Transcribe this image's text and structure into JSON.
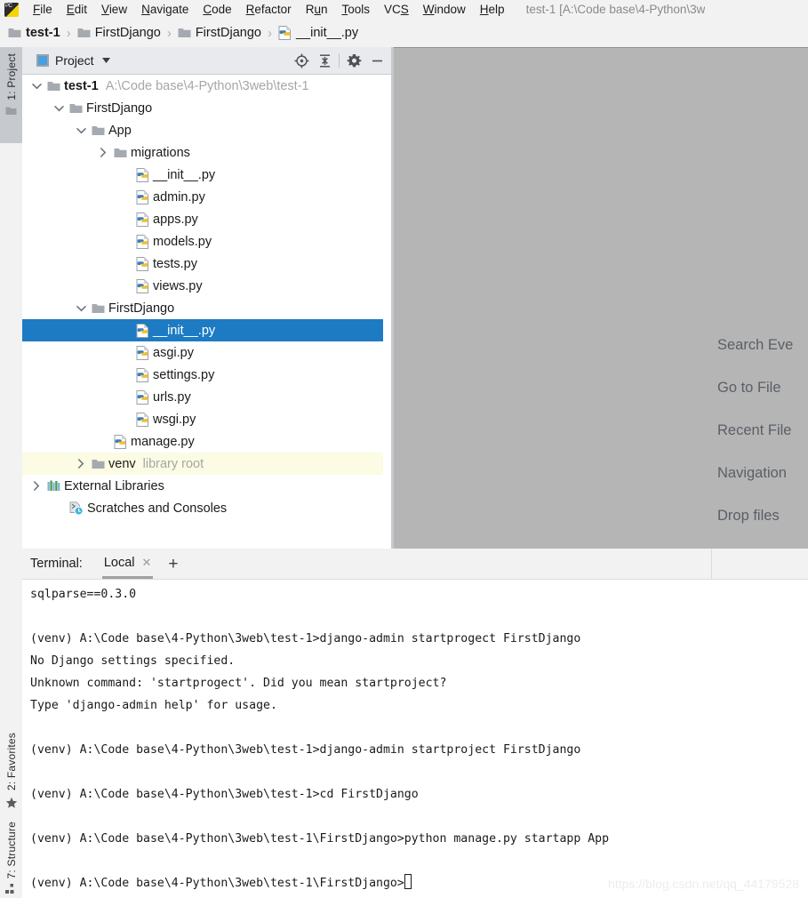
{
  "app": {
    "logo_icon": "pycharm-logo-icon",
    "window_title": "test-1 [A:\\Code base\\4-Python\\3w"
  },
  "menubar": {
    "items": [
      {
        "label": "File",
        "mnemonic": "F"
      },
      {
        "label": "Edit",
        "mnemonic": "E"
      },
      {
        "label": "View",
        "mnemonic": "V"
      },
      {
        "label": "Navigate",
        "mnemonic": "N"
      },
      {
        "label": "Code",
        "mnemonic": "C"
      },
      {
        "label": "Refactor",
        "mnemonic": "R"
      },
      {
        "label": "Run",
        "mnemonic": "u"
      },
      {
        "label": "Tools",
        "mnemonic": "T"
      },
      {
        "label": "VCS",
        "mnemonic": "S"
      },
      {
        "label": "Window",
        "mnemonic": "W"
      },
      {
        "label": "Help",
        "mnemonic": "H"
      }
    ]
  },
  "breadcrumb": {
    "separator": "›",
    "items": [
      {
        "label": "test-1",
        "icon": "folder-icon",
        "bold": true
      },
      {
        "label": "FirstDjango",
        "icon": "folder-icon",
        "bold": false
      },
      {
        "label": "FirstDjango",
        "icon": "folder-icon",
        "bold": false
      },
      {
        "label": "__init__.py",
        "icon": "python-file-icon",
        "bold": false
      }
    ]
  },
  "left_strip": {
    "top_tabs": [
      {
        "label": "1: Project",
        "icon": "folder-icon"
      }
    ],
    "bottom_tabs": [
      {
        "label": "2: Favorites",
        "icon": "star-icon"
      },
      {
        "label": "7: Structure",
        "icon": "structure-icon"
      }
    ]
  },
  "project_panel": {
    "title": "Project",
    "tile_icon": "project-tile-icon",
    "caret_icon": "chevron-down-icon",
    "tools": [
      {
        "name": "locate-icon",
        "tooltip": "Select Opened File"
      },
      {
        "name": "collapse-all-icon",
        "tooltip": "Collapse All"
      },
      {
        "name": "gear-icon",
        "tooltip": "Settings"
      },
      {
        "name": "minimize-icon",
        "tooltip": "Hide"
      }
    ],
    "tree": [
      {
        "label": "test-1",
        "note": "A:\\Code base\\4-Python\\3web\\test-1",
        "indent": 0,
        "arrow": "expanded",
        "icon": "folder-icon",
        "bold": true,
        "state": "normal"
      },
      {
        "label": "FirstDjango",
        "note": "",
        "indent": 1,
        "arrow": "expanded",
        "icon": "folder-icon",
        "bold": false,
        "state": "normal"
      },
      {
        "label": "App",
        "note": "",
        "indent": 2,
        "arrow": "expanded",
        "icon": "folder-icon",
        "bold": false,
        "state": "normal"
      },
      {
        "label": "migrations",
        "note": "",
        "indent": 3,
        "arrow": "collapsed",
        "icon": "folder-icon",
        "bold": false,
        "state": "normal"
      },
      {
        "label": "__init__.py",
        "note": "",
        "indent": 4,
        "arrow": "none",
        "icon": "python-file-icon",
        "bold": false,
        "state": "normal"
      },
      {
        "label": "admin.py",
        "note": "",
        "indent": 4,
        "arrow": "none",
        "icon": "python-file-icon",
        "bold": false,
        "state": "normal"
      },
      {
        "label": "apps.py",
        "note": "",
        "indent": 4,
        "arrow": "none",
        "icon": "python-file-icon",
        "bold": false,
        "state": "normal"
      },
      {
        "label": "models.py",
        "note": "",
        "indent": 4,
        "arrow": "none",
        "icon": "python-file-icon",
        "bold": false,
        "state": "normal"
      },
      {
        "label": "tests.py",
        "note": "",
        "indent": 4,
        "arrow": "none",
        "icon": "python-file-icon",
        "bold": false,
        "state": "normal"
      },
      {
        "label": "views.py",
        "note": "",
        "indent": 4,
        "arrow": "none",
        "icon": "python-file-icon",
        "bold": false,
        "state": "normal"
      },
      {
        "label": "FirstDjango",
        "note": "",
        "indent": 2,
        "arrow": "expanded",
        "icon": "folder-icon",
        "bold": false,
        "state": "normal"
      },
      {
        "label": "__init__.py",
        "note": "",
        "indent": 4,
        "arrow": "none",
        "icon": "python-file-icon",
        "bold": false,
        "state": "selected"
      },
      {
        "label": "asgi.py",
        "note": "",
        "indent": 4,
        "arrow": "none",
        "icon": "python-file-icon",
        "bold": false,
        "state": "normal"
      },
      {
        "label": "settings.py",
        "note": "",
        "indent": 4,
        "arrow": "none",
        "icon": "python-file-icon",
        "bold": false,
        "state": "normal"
      },
      {
        "label": "urls.py",
        "note": "",
        "indent": 4,
        "arrow": "none",
        "icon": "python-file-icon",
        "bold": false,
        "state": "normal"
      },
      {
        "label": "wsgi.py",
        "note": "",
        "indent": 4,
        "arrow": "none",
        "icon": "python-file-icon",
        "bold": false,
        "state": "normal"
      },
      {
        "label": "manage.py",
        "note": "",
        "indent": 3,
        "arrow": "none",
        "icon": "python-file-icon",
        "bold": false,
        "state": "normal"
      },
      {
        "label": "venv",
        "note": "library root",
        "indent": 2,
        "arrow": "collapsed",
        "icon": "folder-icon",
        "bold": false,
        "state": "highlighted"
      },
      {
        "label": "External Libraries",
        "note": "",
        "indent": 0,
        "arrow": "collapsed",
        "icon": "libraries-icon",
        "bold": false,
        "state": "normal"
      },
      {
        "label": "Scratches and Consoles",
        "note": "",
        "indent": 1,
        "arrow": "none",
        "icon": "scratches-icon",
        "bold": false,
        "state": "normal"
      }
    ]
  },
  "editor": {
    "hints": [
      "Search Eve",
      "Go to File ",
      "Recent File",
      "Navigation",
      "Drop files "
    ]
  },
  "terminal": {
    "label": "Terminal:",
    "tab_label": "Local",
    "close_icon": "close-icon",
    "add_icon": "plus-icon",
    "lines": [
      "sqlparse==0.3.0",
      "",
      "(venv) A:\\Code base\\4-Python\\3web\\test-1>django-admin startprogect FirstDjango",
      "No Django settings specified.",
      "Unknown command: 'startprogect'. Did you mean startproject?",
      "Type 'django-admin help' for usage.",
      "",
      "(venv) A:\\Code base\\4-Python\\3web\\test-1>django-admin startproject FirstDjango",
      "",
      "(venv) A:\\Code base\\4-Python\\3web\\test-1>cd FirstDjango",
      "",
      "(venv) A:\\Code base\\4-Python\\3web\\test-1\\FirstDjango>python manage.py startapp App",
      "",
      "(venv) A:\\Code base\\4-Python\\3web\\test-1\\FirstDjango>"
    ]
  },
  "watermark": {
    "text": "https://blog.csdn.net/qq_44179528"
  },
  "colors": {
    "selection_blue": "#1d7bc4",
    "highlight_yellow": "#fcfbe3",
    "editor_gray": "#b5b5b5",
    "panel_header": "#e8eaed",
    "chrome": "#f2f2f2"
  }
}
